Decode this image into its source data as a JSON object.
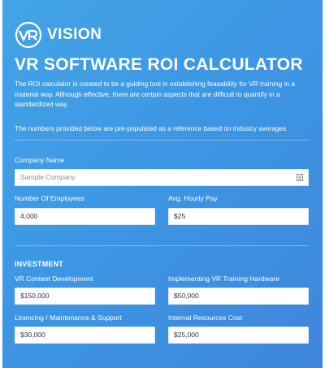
{
  "brand": {
    "name": "VISION",
    "logo_icon": "vr-logo-icon",
    "accent": "#3e95e2"
  },
  "header": {
    "title": "VR SOFTWARE ROI CALCULATOR",
    "intro": "The ROI calculator is created to be a guiding tool in establishing feasability for VR training in a material way. Although effective, there are certain aspects that are difficult to quantify in a standardized way.",
    "note": "The numbers provided below are pre-populated as a reference based on industry averages"
  },
  "company": {
    "company_name_label": "Company Name",
    "company_name_placeholder": "Sample Company",
    "company_name_icon": "contact-card-icon",
    "employees_label": "Number Of Employees",
    "employees_value": "4,000",
    "hourly_pay_label": "Avg. Hourly Pay",
    "hourly_pay_value": "$25"
  },
  "investment": {
    "heading": "INVESTMENT",
    "content_dev_label": "VR Content Development",
    "content_dev_value": "$150,000",
    "hardware_label": "Implementing VR Training Hardware",
    "hardware_value": "$50,000",
    "licensing_label": "Licencing / Maintenance & Support",
    "licensing_value": "$30,000",
    "internal_label": "Internal Resources Cost",
    "internal_value": "$25,000"
  }
}
